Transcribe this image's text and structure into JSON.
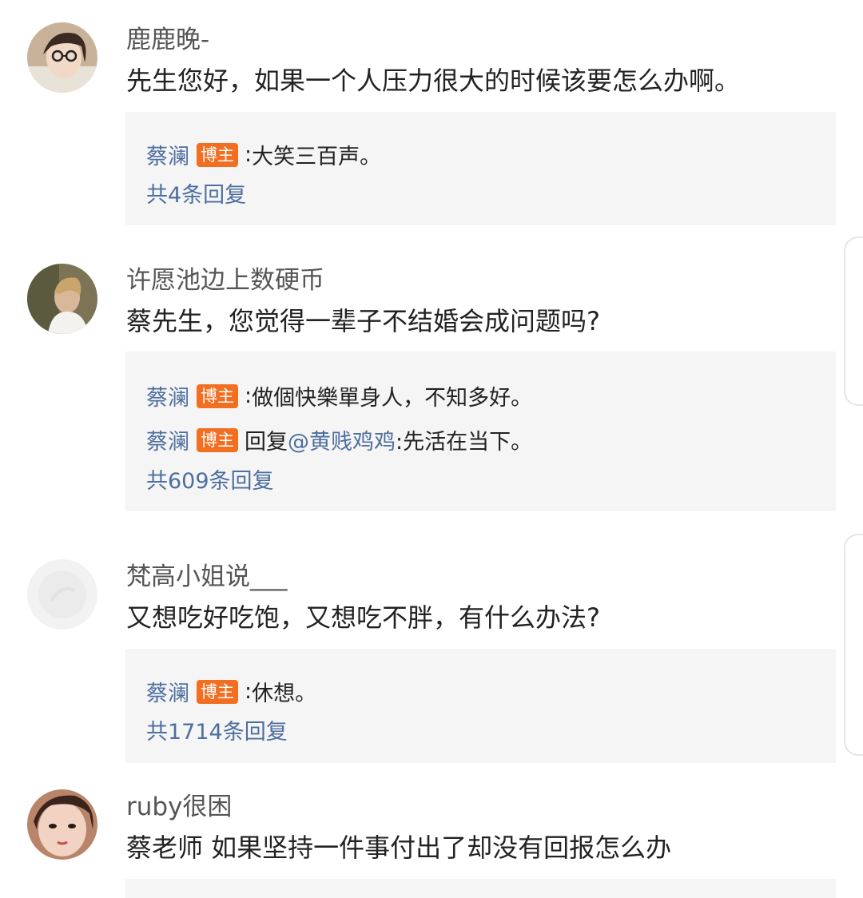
{
  "badge_label": "博主",
  "comments": [
    {
      "username": "鹿鹿晚-",
      "text": "先生您好，如果一个人压力很大的时候该要怎么办啊。",
      "replies": [
        {
          "author": "蔡澜",
          "prefix": ": ",
          "mention": "",
          "content": "大笑三百声。"
        }
      ],
      "reply_count": "共4条回复"
    },
    {
      "username": "许愿池边上数硬币",
      "text": "蔡先生，您觉得一辈子不结婚会成问题吗?",
      "replies": [
        {
          "author": "蔡澜",
          "prefix": ": ",
          "mention": "",
          "content": "做個快樂單身人，不知多好。"
        },
        {
          "author": "蔡澜",
          "prefix": " 回复",
          "mention": "@黄贱鸡鸡",
          "content": ":先活在当下。"
        }
      ],
      "reply_count": "共609条回复"
    },
    {
      "username": "梵高小姐说___",
      "text": "又想吃好吃饱，又想吃不胖，有什么办法?",
      "replies": [
        {
          "author": "蔡澜",
          "prefix": ": ",
          "mention": "",
          "content": "休想。"
        }
      ],
      "reply_count": "共1714条回复"
    },
    {
      "username": "ruby很困",
      "text": "蔡老师 如果坚持一件事付出了却没有回报怎么办",
      "replies": [],
      "reply_count": ""
    }
  ]
}
